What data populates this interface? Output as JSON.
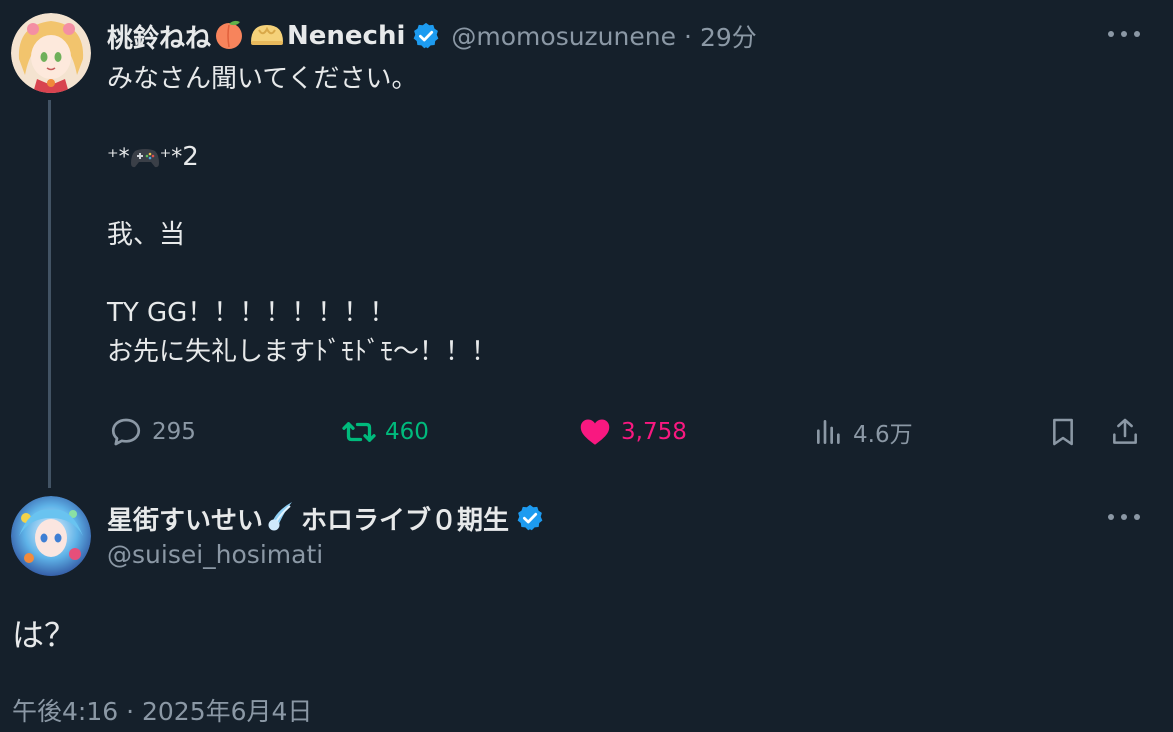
{
  "tweet1": {
    "display_name": "桃鈴ねね",
    "display_name_suffix": "Nenechi",
    "name_emojis": [
      "peach-emoji",
      "bun-emoji"
    ],
    "handle": "@momosuzunene",
    "separator": "·",
    "time": "29分",
    "body_lines": [
      "みなさん聞いてください。",
      "",
      "*⁺🎮⁺*2",
      "",
      "我、当",
      "",
      "TY GG！！！！！！！！",
      "お先に失礼しますﾄﾞﾓﾄﾞﾓ～！！！"
    ],
    "stats": {
      "replies": "295",
      "retweets": "460",
      "likes": "3,758",
      "views": "4.6万"
    },
    "colors": {
      "retweet": "#00ba7c",
      "like": "#f91880",
      "verified": "#1d9bf0"
    }
  },
  "tweet2": {
    "display_name": "星街すいせい",
    "display_name_suffix": "ホロライブ０期生",
    "name_emojis": [
      "comet-emoji"
    ],
    "handle": "@suisei_hosimati",
    "body": "は？",
    "timestamp": "午後4:16 · 2025年6月4日"
  }
}
